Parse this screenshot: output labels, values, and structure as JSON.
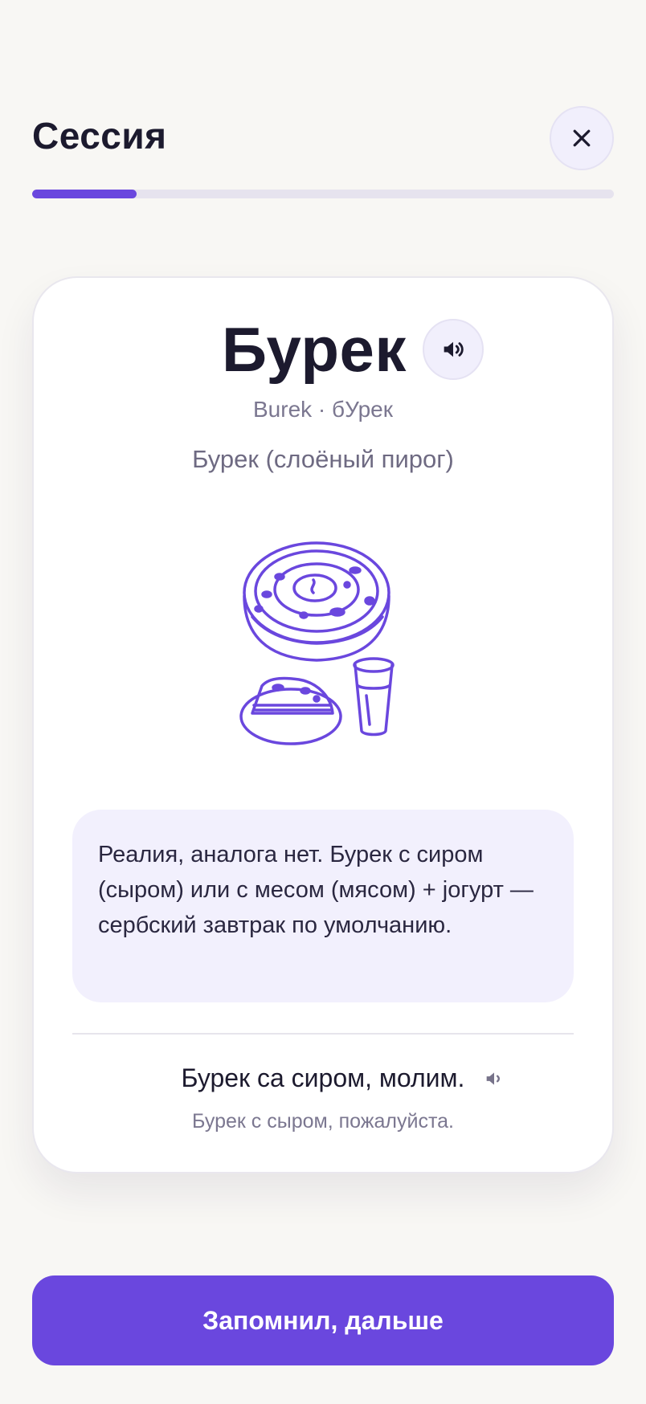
{
  "header": {
    "title": "Сессия",
    "close_icon": "close-icon"
  },
  "progress": {
    "fraction": 0.18,
    "color": "#6A47DE"
  },
  "card": {
    "word": "Бурек",
    "transliteration": "Burek · бУрек",
    "translation": "Бурек (слоёный пирог)",
    "illustration_icon": "burek-illustration",
    "note": "Реалия, аналога нет. Бурек с сиром (сыром) или с месом (мясом) + jогурт — сербский завтрак по умолчанию.",
    "example": "Бурек са сиром, молим.",
    "example_translation": "Бурек с сыром, пожалуйста."
  },
  "footer": {
    "next_label": "Запомнил, дальше"
  },
  "colors": {
    "accent": "#6A47DE",
    "background": "#F8F7F4",
    "note_bg": "#F2F0FD"
  }
}
